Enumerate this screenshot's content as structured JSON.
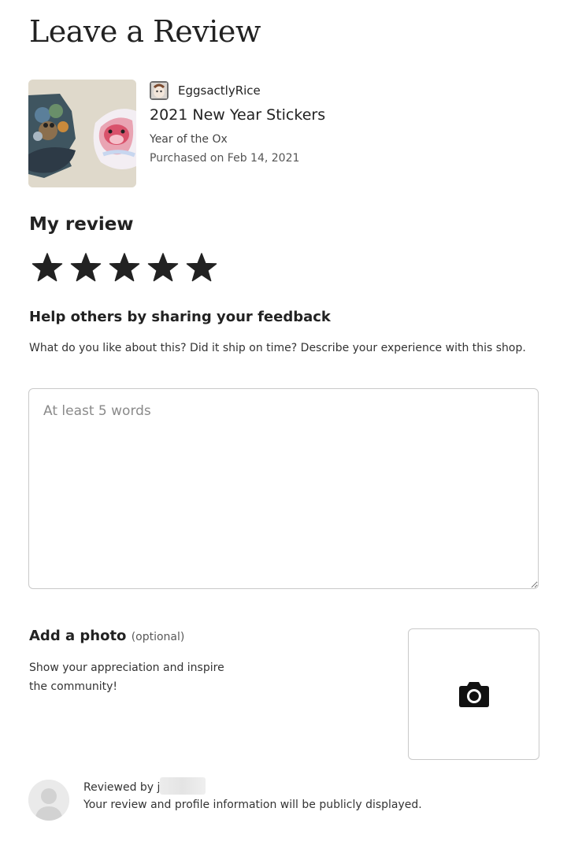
{
  "page": {
    "title": "Leave a Review"
  },
  "product": {
    "shop_name": "EggsactlyRice",
    "title": "2021 New Year Stickers",
    "variant": "Year of the Ox",
    "purchased": "Purchased on Feb 14, 2021"
  },
  "rating": {
    "heading": "My review",
    "value": 5,
    "max": 5,
    "star_color": "#222222"
  },
  "feedback": {
    "heading": "Help others by sharing your feedback",
    "help": "What do you like about this? Did it ship on time? Describe your experience with this shop.",
    "value": "",
    "placeholder": "At least 5 words"
  },
  "photo": {
    "heading": "Add a photo",
    "optional_label": "(optional)",
    "help": "Show your appreciation and inspire the community!",
    "icon": "camera-icon"
  },
  "footer": {
    "reviewed_by_label": "Reviewed by j",
    "public_note": "Your review and profile information will be publicly displayed."
  }
}
